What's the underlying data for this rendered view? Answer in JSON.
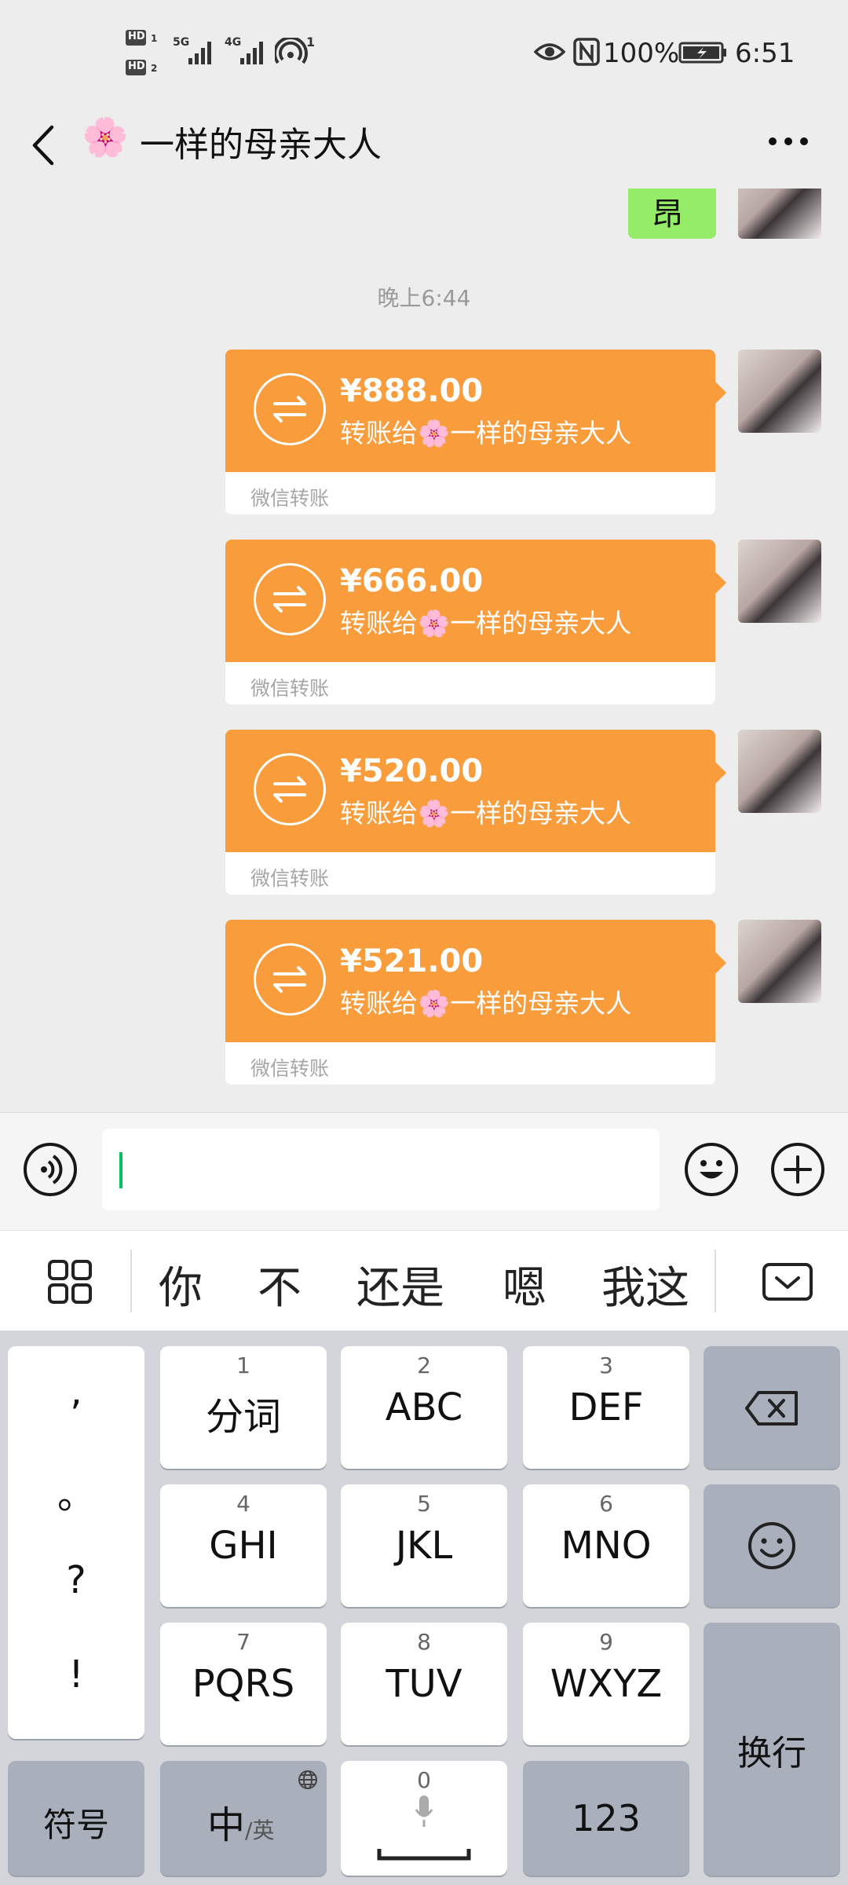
{
  "status_bar": {
    "hd1": "HD",
    "hd2": "HD",
    "sim1": "1",
    "sim2": "2",
    "net1": "5G",
    "net2": "4G",
    "hotspot_count": "1",
    "battery": "100%",
    "time": "6:51"
  },
  "header": {
    "title": "一样的母亲大人",
    "title_emoji": "🌸"
  },
  "chat": {
    "partial_message": "昂",
    "time_label": "晚上6:44",
    "transfers": [
      {
        "amount": "¥888.00",
        "desc_prefix": "转账给",
        "desc_emoji": "🌸",
        "desc_name": "一样的母亲大人",
        "footer": "微信转账"
      },
      {
        "amount": "¥666.00",
        "desc_prefix": "转账给",
        "desc_emoji": "🌸",
        "desc_name": "一样的母亲大人",
        "footer": "微信转账"
      },
      {
        "amount": "¥520.00",
        "desc_prefix": "转账给",
        "desc_emoji": "🌸",
        "desc_name": "一样的母亲大人",
        "footer": "微信转账"
      },
      {
        "amount": "¥521.00",
        "desc_prefix": "转账给",
        "desc_emoji": "🌸",
        "desc_name": "一样的母亲大人",
        "footer": "微信转账"
      }
    ]
  },
  "input": {
    "value": ""
  },
  "candidates": {
    "items": [
      "你",
      "不",
      "还是",
      "嗯",
      "我这"
    ]
  },
  "keyboard": {
    "punct": [
      ",",
      "。",
      "?",
      "!"
    ],
    "keys": [
      {
        "num": "1",
        "label": "分词"
      },
      {
        "num": "2",
        "label": "ABC"
      },
      {
        "num": "3",
        "label": "DEF"
      },
      {
        "num": "4",
        "label": "GHI"
      },
      {
        "num": "5",
        "label": "JKL"
      },
      {
        "num": "6",
        "label": "MNO"
      },
      {
        "num": "7",
        "label": "PQRS"
      },
      {
        "num": "8",
        "label": "TUV"
      },
      {
        "num": "9",
        "label": "WXYZ"
      }
    ],
    "symbol_label": "符号",
    "lang_main": "中",
    "lang_sub": "/英",
    "space_num": "0",
    "num_label": "123",
    "enter_label": "换行"
  },
  "colors": {
    "accent_green": "#07c160",
    "transfer_orange": "#f89c3c",
    "bubble_green": "#95ec69"
  }
}
